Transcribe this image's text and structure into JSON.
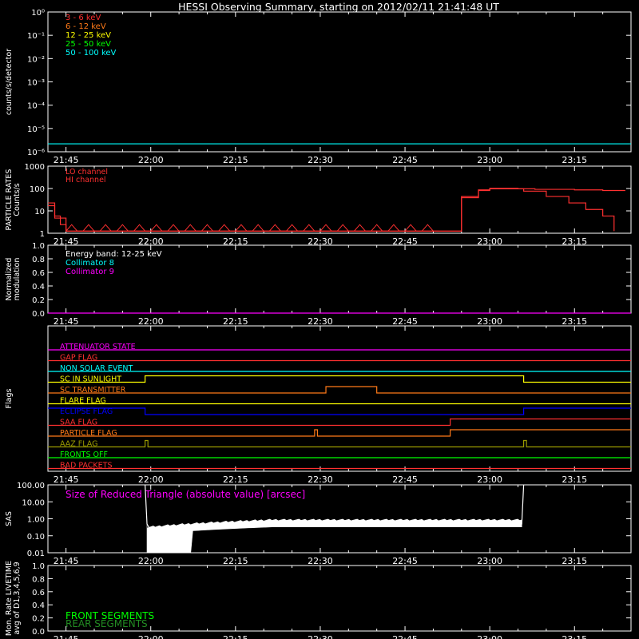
{
  "title": "HESSI Observing Summary, starting on 2012/02/11 21:41:48 UT",
  "time_ticks": [
    "21:45",
    "22:00",
    "22:15",
    "22:30",
    "22:45",
    "23:00",
    "23:15"
  ],
  "colors": {
    "bg": "#000000",
    "axis": "#ffffff",
    "red": "#ff3030",
    "orange": "#ff7a18",
    "yellow": "#ffff00",
    "green": "#00ff00",
    "cyan": "#00ffff",
    "magenta": "#ff00ff",
    "blue": "#0000ff",
    "olive": "#9a9a00"
  },
  "chart_data": [
    {
      "id": "count-rates",
      "type": "line",
      "ylabel": "counts/s/detector",
      "y_scale": "log",
      "ylim": [
        0.5,
        100000
      ],
      "ytick_labels": [
        "10⁰",
        "10⁻¹",
        "10⁻²",
        "10⁻³",
        "10⁻⁴",
        "10⁻⁵",
        "10⁻⁶"
      ],
      "legend": [
        {
          "name": "3 - 6 keV",
          "color": "#ff3030"
        },
        {
          "name": "6 - 12 keV",
          "color": "#ff7a18"
        },
        {
          "name": "12 - 25 keV",
          "color": "#ffff00"
        },
        {
          "name": "25 - 50 keV",
          "color": "#00ff00"
        },
        {
          "name": "50 - 100 keV",
          "color": "#00ffff"
        }
      ],
      "series": [
        {
          "name": "50 - 100 keV",
          "color": "#00ffff",
          "x": [
            "21:41:48",
            "23:25"
          ],
          "y": [
            1,
            1
          ]
        }
      ]
    },
    {
      "id": "particle-rates",
      "type": "line",
      "ylabel_lines": [
        "PARTICLE RATES",
        "Counts/s"
      ],
      "y_scale": "log",
      "ylim": [
        0.8,
        1000
      ],
      "ytick_labels": [
        "1000",
        "100",
        "10",
        "1"
      ],
      "legend": [
        {
          "name": "LO channel",
          "color": "#ff3030"
        },
        {
          "name": "HI channel",
          "color": "#ff3030"
        }
      ],
      "series": [
        {
          "name": "LO channel",
          "color": "#ff3030",
          "x": [
            "21:41:48",
            "21:43",
            "21:44",
            "21:45",
            "22:52",
            "22:55",
            "22:58",
            "23:00",
            "23:02",
            "23:05",
            "23:08",
            "23:12",
            "23:15",
            "23:20",
            "23:24"
          ],
          "y": [
            20,
            5,
            2,
            1,
            1,
            40,
            80,
            95,
            95,
            90,
            85,
            85,
            80,
            75,
            75
          ]
        },
        {
          "name": "HI channel",
          "color": "#ff3030",
          "x": [
            "21:41:48",
            "21:43",
            "21:45",
            "22:52",
            "22:55",
            "22:58",
            "23:00",
            "23:03",
            "23:06",
            "23:10",
            "23:14",
            "23:17",
            "23:20",
            "23:22"
          ],
          "y": [
            15,
            4,
            1,
            1,
            35,
            75,
            90,
            90,
            70,
            40,
            20,
            10,
            5,
            1
          ]
        }
      ]
    },
    {
      "id": "modulation",
      "type": "line",
      "ylabel_lines": [
        "Normalized",
        "modulation"
      ],
      "ylim": [
        0,
        1.0
      ],
      "ytick_labels": [
        "1.0",
        "0.8",
        "0.6",
        "0.4",
        "0.2",
        "0.0"
      ],
      "legend": [
        {
          "name": "Energy band: 12-25 keV",
          "color": "#ffffff"
        },
        {
          "name": "Collimator 8",
          "color": "#00ffff"
        },
        {
          "name": "Collimator 9",
          "color": "#ff00ff"
        }
      ],
      "series": [
        {
          "name": "Collimator 9",
          "color": "#ff00ff",
          "x": [
            "21:41:48",
            "23:25"
          ],
          "y": [
            0,
            0
          ]
        }
      ]
    },
    {
      "id": "flags",
      "type": "line",
      "ylabel": "Flags",
      "flags": [
        {
          "name": "ATTENUATOR STATE",
          "color": "#ff00ff",
          "steps": [
            [
              "21:41:48",
              0
            ]
          ]
        },
        {
          "name": "GAP FLAG",
          "color": "#ff3030",
          "steps": [
            [
              "21:41:48",
              0
            ]
          ]
        },
        {
          "name": "NON SOLAR EVENT",
          "color": "#00ffff",
          "steps": [
            [
              "21:41:48",
              0
            ]
          ]
        },
        {
          "name": "SC IN SUNLIGHT",
          "color": "#ffff00",
          "steps": [
            [
              "21:41:48",
              0
            ],
            [
              "21:59",
              1
            ],
            [
              "23:06",
              0
            ]
          ]
        },
        {
          "name": "SC TRANSMITTER",
          "color": "#ff7a18",
          "steps": [
            [
              "21:41:48",
              0
            ],
            [
              "22:31",
              1
            ],
            [
              "22:40",
              0
            ]
          ]
        },
        {
          "name": "FLARE FLAG",
          "color": "#ffff00",
          "steps": [
            [
              "21:41:48",
              0
            ]
          ]
        },
        {
          "name": "ECLIPSE FLAG",
          "color": "#0000ff",
          "steps": [
            [
              "21:41:48",
              1
            ],
            [
              "21:59",
              0
            ],
            [
              "23:06",
              1
            ]
          ]
        },
        {
          "name": "SAA FLAG",
          "color": "#ff3030",
          "steps": [
            [
              "21:41:48",
              0
            ],
            [
              "22:53",
              1
            ]
          ]
        },
        {
          "name": "PARTICLE FLAG",
          "color": "#ff7a18",
          "steps": [
            [
              "21:41:48",
              0
            ],
            [
              "22:29",
              1
            ],
            [
              "22:29:30",
              0
            ],
            [
              "22:53",
              1
            ]
          ]
        },
        {
          "name": "AAZ FLAG",
          "color": "#9a9a00",
          "steps": [
            [
              "21:41:48",
              0
            ],
            [
              "21:59",
              1
            ],
            [
              "21:59:30",
              0
            ],
            [
              "23:06",
              1
            ],
            [
              "23:06:30",
              0
            ]
          ]
        },
        {
          "name": "FRONTS OFF",
          "color": "#00ff00",
          "steps": [
            [
              "21:41:48",
              0
            ]
          ]
        },
        {
          "name": "BAD PACKETS",
          "color": "#ff3030",
          "steps": [
            [
              "21:41:48",
              0
            ]
          ]
        }
      ]
    },
    {
      "id": "sas",
      "type": "line",
      "ylabel": "SAS",
      "y_scale": "log",
      "ylim": [
        0.01,
        100
      ],
      "ytick_labels": [
        "100.00",
        "10.00",
        "1.00",
        "0.10",
        "0.01"
      ],
      "legend": [
        {
          "name": "Size of Reduced Triangle (absolute value) [arcsec]",
          "color": "#ff00ff"
        }
      ],
      "series": [
        {
          "name": "Size of Reduced Triangle (absolute value) [arcsec]",
          "color": "#ffffff",
          "x": [
            "21:59",
            "21:59:20",
            "22:00",
            "22:02",
            "22:05",
            "22:10",
            "22:20",
            "22:35",
            "22:50",
            "23:05",
            "23:05:40",
            "23:06"
          ],
          "y": [
            100,
            0.5,
            0.2,
            0.25,
            0.3,
            0.35,
            0.45,
            0.5,
            0.55,
            0.55,
            0.5,
            100
          ]
        }
      ]
    },
    {
      "id": "monitor-rate",
      "type": "line",
      "ylabel_lines": [
        "Mon. Rate LIVETIME",
        "avg of D1,3,4,5,6,9"
      ],
      "ylim": [
        0,
        1.0
      ],
      "ytick_labels": [
        "1.0",
        "0.8",
        "0.6",
        "0.4",
        "0.2",
        "0.0"
      ],
      "legend": [
        {
          "name": "FRONT SEGMENTS",
          "color": "#00ff00"
        },
        {
          "name": "REAR SEGMENTS",
          "color": "#228b22"
        }
      ],
      "series": []
    }
  ]
}
